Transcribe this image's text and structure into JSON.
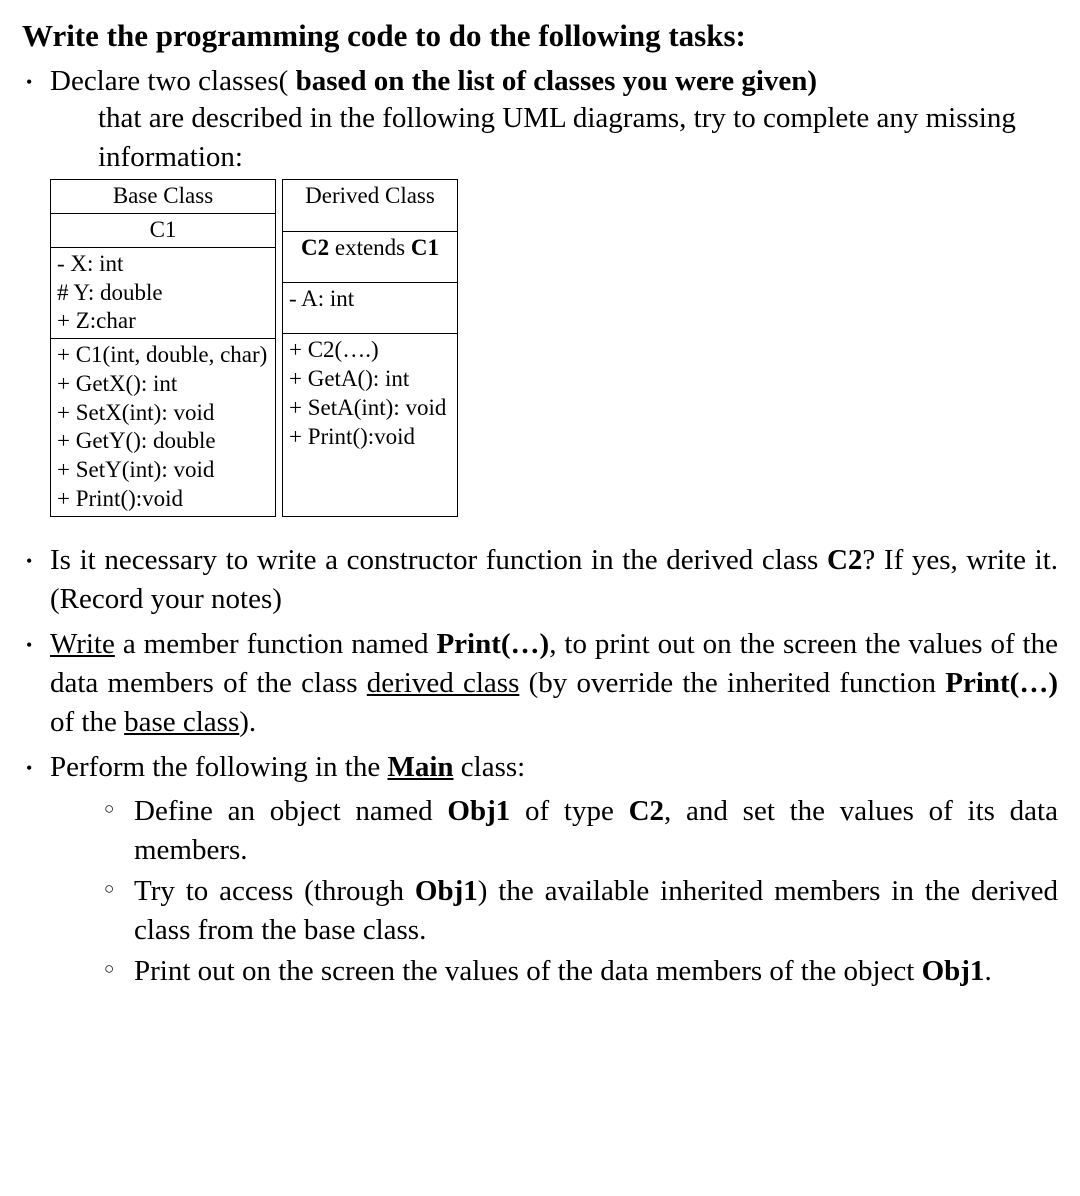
{
  "title": "Write the programming code to do the following tasks:",
  "bullets": {
    "b1_lead": "Declare two classes(",
    "b1_bold": " based on the list of classes you were given)",
    "b1_hang": "that are described in the following UML diagrams, try to complete any missing information:",
    "b2_a": "Is it necessary to write a constructor function in the derived class ",
    "b2_bold": "C2",
    "b2_b": "? If yes, write it. (Record your notes)",
    "b3_write": "Write",
    "b3_a": " a member function named ",
    "b3_bold1": "Print(…)",
    "b3_b": ", to print out on the screen the values of the data members of the class ",
    "b3_ul1": "derived class",
    "b3_c": " (by override the inherited function ",
    "b3_bold2": "Print(…)",
    "b3_d": " of the ",
    "b3_ul2": "base class",
    "b3_e": ").",
    "b4_a": "Perform the following in the ",
    "b4_main": "Main",
    "b4_b": " class:",
    "s1_a": "Define an object named ",
    "s1_obj": "Obj1",
    "s1_b": " of type ",
    "s1_c2": "C2",
    "s1_c": ", and set the values of its data members.",
    "s2_a": "Try to access (through ",
    "s2_obj": "Obj1",
    "s2_b": ") the available inherited members in the derived class from the base class.",
    "s3_a": "Print out on the screen the values of the data members of the object ",
    "s3_obj": "Obj1",
    "s3_b": "."
  },
  "uml": {
    "base": {
      "header": "Base Class",
      "name": "C1",
      "attrs": "- X: int\n# Y: double\n+ Z:char",
      "methods": "+ C1(int, double, char)\n+ GetX(): int\n+ SetX(int): void\n+ GetY(): double\n+ SetY(int): void\n+ Print():void"
    },
    "derived": {
      "header": "Derived Class",
      "name_a": "C2",
      "name_mid": " extends ",
      "name_b": "C1",
      "attrs": "- A: int",
      "methods": "+ C2(….)\n+ GetA(): int\n+ SetA(int): void\n+ Print():void"
    }
  }
}
